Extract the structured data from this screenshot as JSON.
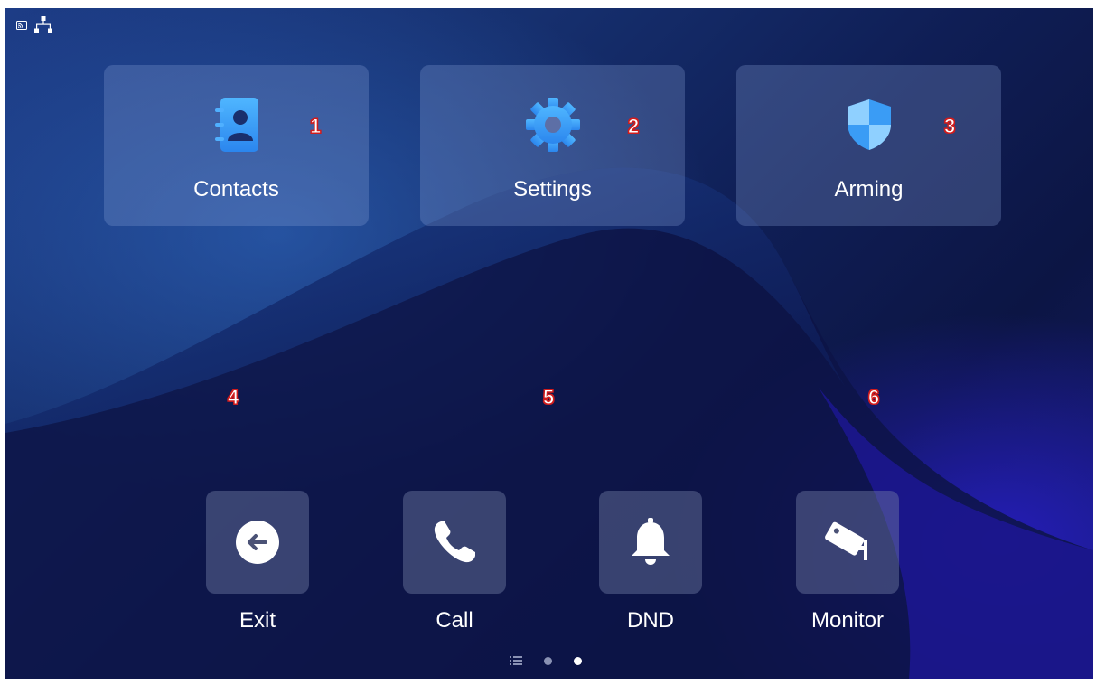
{
  "status_bar": {
    "icons": [
      "cast-icon",
      "network-icon"
    ]
  },
  "apps": [
    {
      "label": "Contacts",
      "marker": "1",
      "icon": "contacts-book-icon"
    },
    {
      "label": "Settings",
      "marker": "2",
      "icon": "gear-icon"
    },
    {
      "label": "Arming",
      "marker": "3",
      "icon": "shield-icon"
    }
  ],
  "markers_row2": [
    "4",
    "5",
    "6"
  ],
  "dock": [
    {
      "label": "Exit",
      "icon": "exit-arrow-icon"
    },
    {
      "label": "Call",
      "icon": "phone-icon"
    },
    {
      "label": "DND",
      "icon": "bell-icon"
    },
    {
      "label": "Monitor",
      "icon": "camera-icon"
    }
  ],
  "pager": {
    "pages": 3,
    "active": 3
  },
  "colors": {
    "accent": "#3fa3f5",
    "marker_outline": "#d11c1c"
  }
}
